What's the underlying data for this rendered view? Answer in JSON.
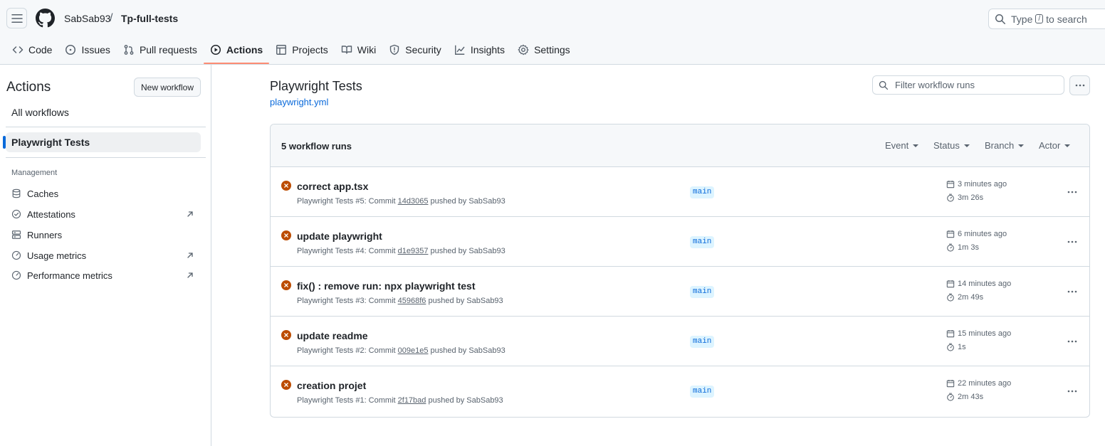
{
  "header": {
    "owner": "SabSab93",
    "separator": "/",
    "repo": "Tp-full-tests",
    "search": {
      "prefix": "Type",
      "key": "/",
      "suffix": "to search"
    }
  },
  "tabs": [
    {
      "label": "Code",
      "icon": "code-icon"
    },
    {
      "label": "Issues",
      "icon": "issue-opened-icon"
    },
    {
      "label": "Pull requests",
      "icon": "git-pull-request-icon"
    },
    {
      "label": "Actions",
      "icon": "play-icon",
      "selected": true
    },
    {
      "label": "Projects",
      "icon": "table-icon"
    },
    {
      "label": "Wiki",
      "icon": "book-icon"
    },
    {
      "label": "Security",
      "icon": "shield-icon"
    },
    {
      "label": "Insights",
      "icon": "graph-icon"
    },
    {
      "label": "Settings",
      "icon": "gear-icon"
    }
  ],
  "sidebar": {
    "title": "Actions",
    "new_workflow": "New workflow",
    "all_workflows": "All workflows",
    "selected_workflow": "Playwright Tests",
    "management_label": "Management",
    "items": [
      {
        "label": "Caches",
        "icon": "database-icon",
        "external": false
      },
      {
        "label": "Attestations",
        "icon": "verified-icon",
        "external": true
      },
      {
        "label": "Runners",
        "icon": "server-icon",
        "external": false
      },
      {
        "label": "Usage metrics",
        "icon": "meter-icon",
        "external": true
      },
      {
        "label": "Performance metrics",
        "icon": "meter-icon",
        "external": true
      }
    ]
  },
  "main": {
    "workflow_title": "Playwright Tests",
    "workflow_file": "playwright.yml",
    "filter_placeholder": "Filter workflow runs",
    "runs_count": "5 workflow runs",
    "filters": [
      "Event",
      "Status",
      "Branch",
      "Actor"
    ],
    "runs": [
      {
        "title": "correct app.tsx",
        "meta_prefix": "Playwright Tests #5: Commit",
        "sha": "14d3065",
        "meta_suffix": "pushed by SabSab93",
        "branch": "main",
        "time": "3 minutes ago",
        "duration": "3m 26s",
        "status": "failure"
      },
      {
        "title": "update playwright",
        "meta_prefix": "Playwright Tests #4: Commit",
        "sha": "d1e9357",
        "meta_suffix": "pushed by SabSab93",
        "branch": "main",
        "time": "6 minutes ago",
        "duration": "1m 3s",
        "status": "failure"
      },
      {
        "title": "fix() : remove run: npx playwright test",
        "meta_prefix": "Playwright Tests #3: Commit",
        "sha": "45968f6",
        "meta_suffix": "pushed by SabSab93",
        "branch": "main",
        "time": "14 minutes ago",
        "duration": "2m 49s",
        "status": "failure"
      },
      {
        "title": "update readme",
        "meta_prefix": "Playwright Tests #2: Commit",
        "sha": "009e1e5",
        "meta_suffix": "pushed by SabSab93",
        "branch": "main",
        "time": "15 minutes ago",
        "duration": "1s",
        "status": "failure"
      },
      {
        "title": "creation projet",
        "meta_prefix": "Playwright Tests #1: Commit",
        "sha": "2f17bad",
        "meta_suffix": "pushed by SabSab93",
        "branch": "main",
        "time": "22 minutes ago",
        "duration": "2m 43s",
        "status": "failure"
      }
    ]
  },
  "colors": {
    "failure": "#bc4c00",
    "link": "#0969da",
    "tab_underline": "#fd8c73",
    "branch_bg": "#ddf4ff"
  }
}
